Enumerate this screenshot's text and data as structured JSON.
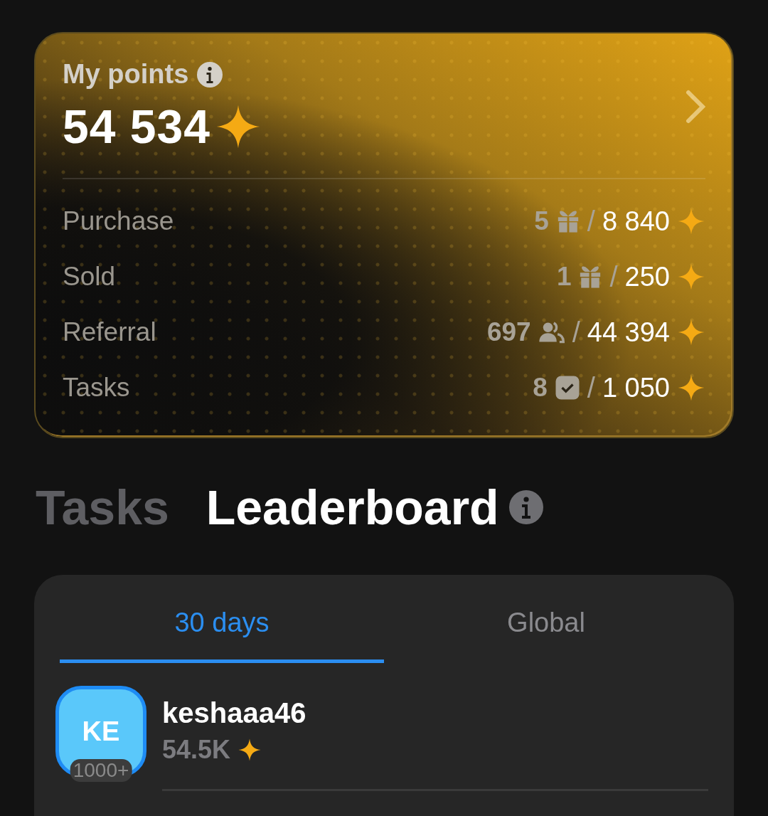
{
  "points_card": {
    "title": "My points",
    "total": "54 534",
    "stats": [
      {
        "label": "Purchase",
        "count": "5",
        "kind": "gift",
        "separator": "/",
        "points": "8 840"
      },
      {
        "label": "Sold",
        "count": "1",
        "kind": "gift",
        "separator": "/",
        "points": "250"
      },
      {
        "label": "Referral",
        "count": "697",
        "kind": "people",
        "separator": "/",
        "points": "44 394"
      },
      {
        "label": "Tasks",
        "count": "8",
        "kind": "check",
        "separator": "/",
        "points": "1 050"
      }
    ]
  },
  "section_tabs": [
    {
      "label": "Tasks",
      "selected": false
    },
    {
      "label": "Leaderboard",
      "selected": true
    }
  ],
  "leaderboard": {
    "tabs": [
      {
        "label": "30 days",
        "selected": true
      },
      {
        "label": "Global",
        "selected": false
      }
    ],
    "rows": [
      {
        "initials": "KE",
        "rank": "1000+",
        "name": "keshaaa46",
        "score": "54.5K"
      }
    ]
  }
}
